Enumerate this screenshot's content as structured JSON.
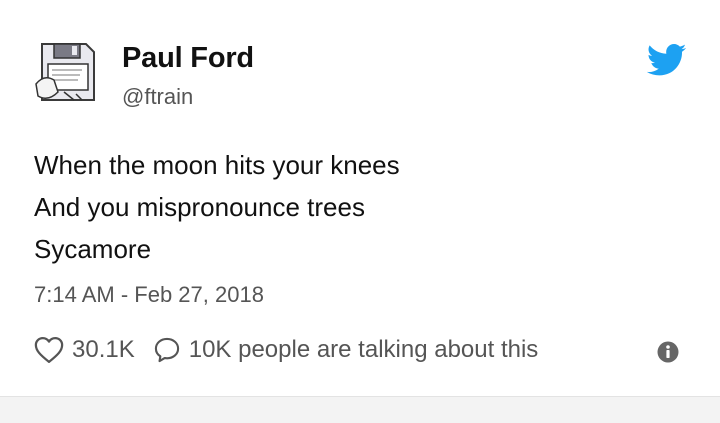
{
  "tweet": {
    "author_name": "Paul Ford",
    "author_handle": "@ftrain",
    "text_lines": [
      "When the moon hits your knees",
      "And you mispronounce trees",
      "Sycamore"
    ],
    "timestamp": "7:14 AM - Feb 27, 2018",
    "likes": "30.1K",
    "conversation": "10K people are talking about this"
  },
  "icons": {
    "avatar": "floppy-disk-avatar",
    "brand": "twitter-bird-icon",
    "like": "heart-icon",
    "reply": "speech-bubble-icon",
    "info": "info-icon"
  },
  "colors": {
    "twitter_blue": "#1da1f2",
    "secondary_text": "#555555",
    "primary_text": "#111111"
  }
}
